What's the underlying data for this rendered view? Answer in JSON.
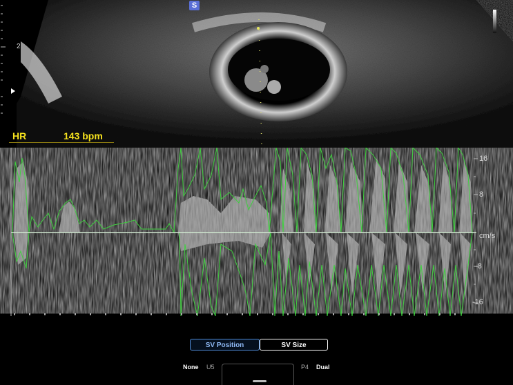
{
  "bmode": {
    "badge": "S",
    "depth_mark": "2",
    "heart_rate": {
      "label": "HR",
      "value": "143 bpm"
    }
  },
  "doppler": {
    "ticks": [
      "16",
      "8",
      "-8",
      "-16"
    ],
    "unit": "cm/s"
  },
  "controls": {
    "sv_position": "SV Position",
    "sv_size": "SV Size",
    "left_label": "None",
    "left_value": "U5",
    "right_value": "P4",
    "right_label": "Dual"
  },
  "icons": [
    "focus-marker-icon",
    "grey-scale-bar",
    "knob-icon"
  ]
}
